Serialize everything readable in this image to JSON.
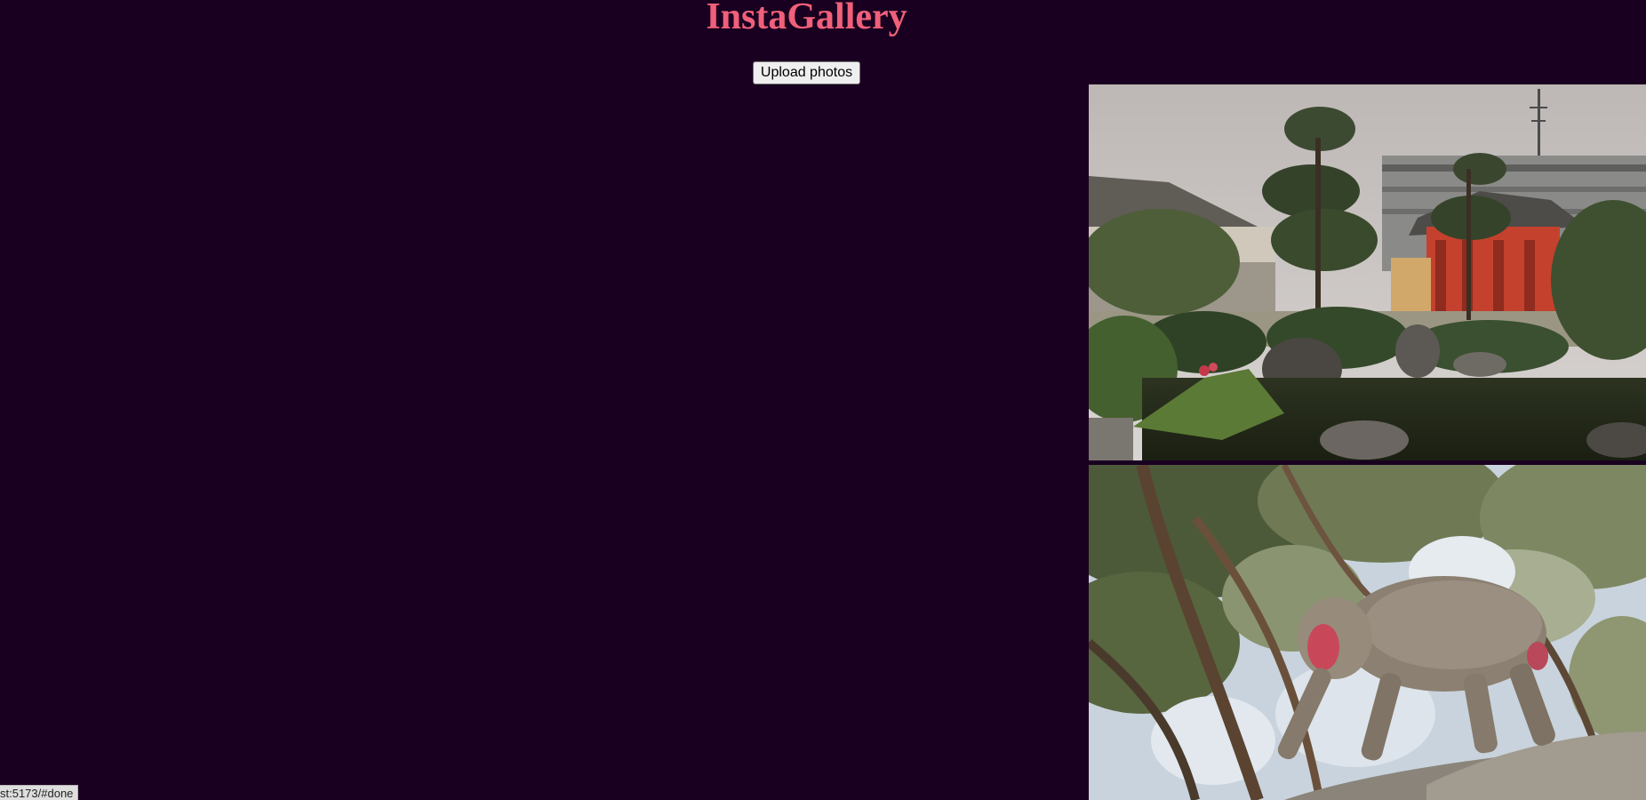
{
  "header": {
    "title": "InstaGallery",
    "upload_label": "Upload photos"
  },
  "gallery": {
    "photos": [
      {
        "subject": "japanese-temple-garden-pond"
      },
      {
        "subject": "japanese-macaque-on-rock"
      }
    ]
  },
  "status_bar": {
    "url": "st:5173/#done"
  },
  "colors": {
    "background": "#1a0020",
    "title": "#f0607a",
    "button_bg": "#efefef"
  }
}
